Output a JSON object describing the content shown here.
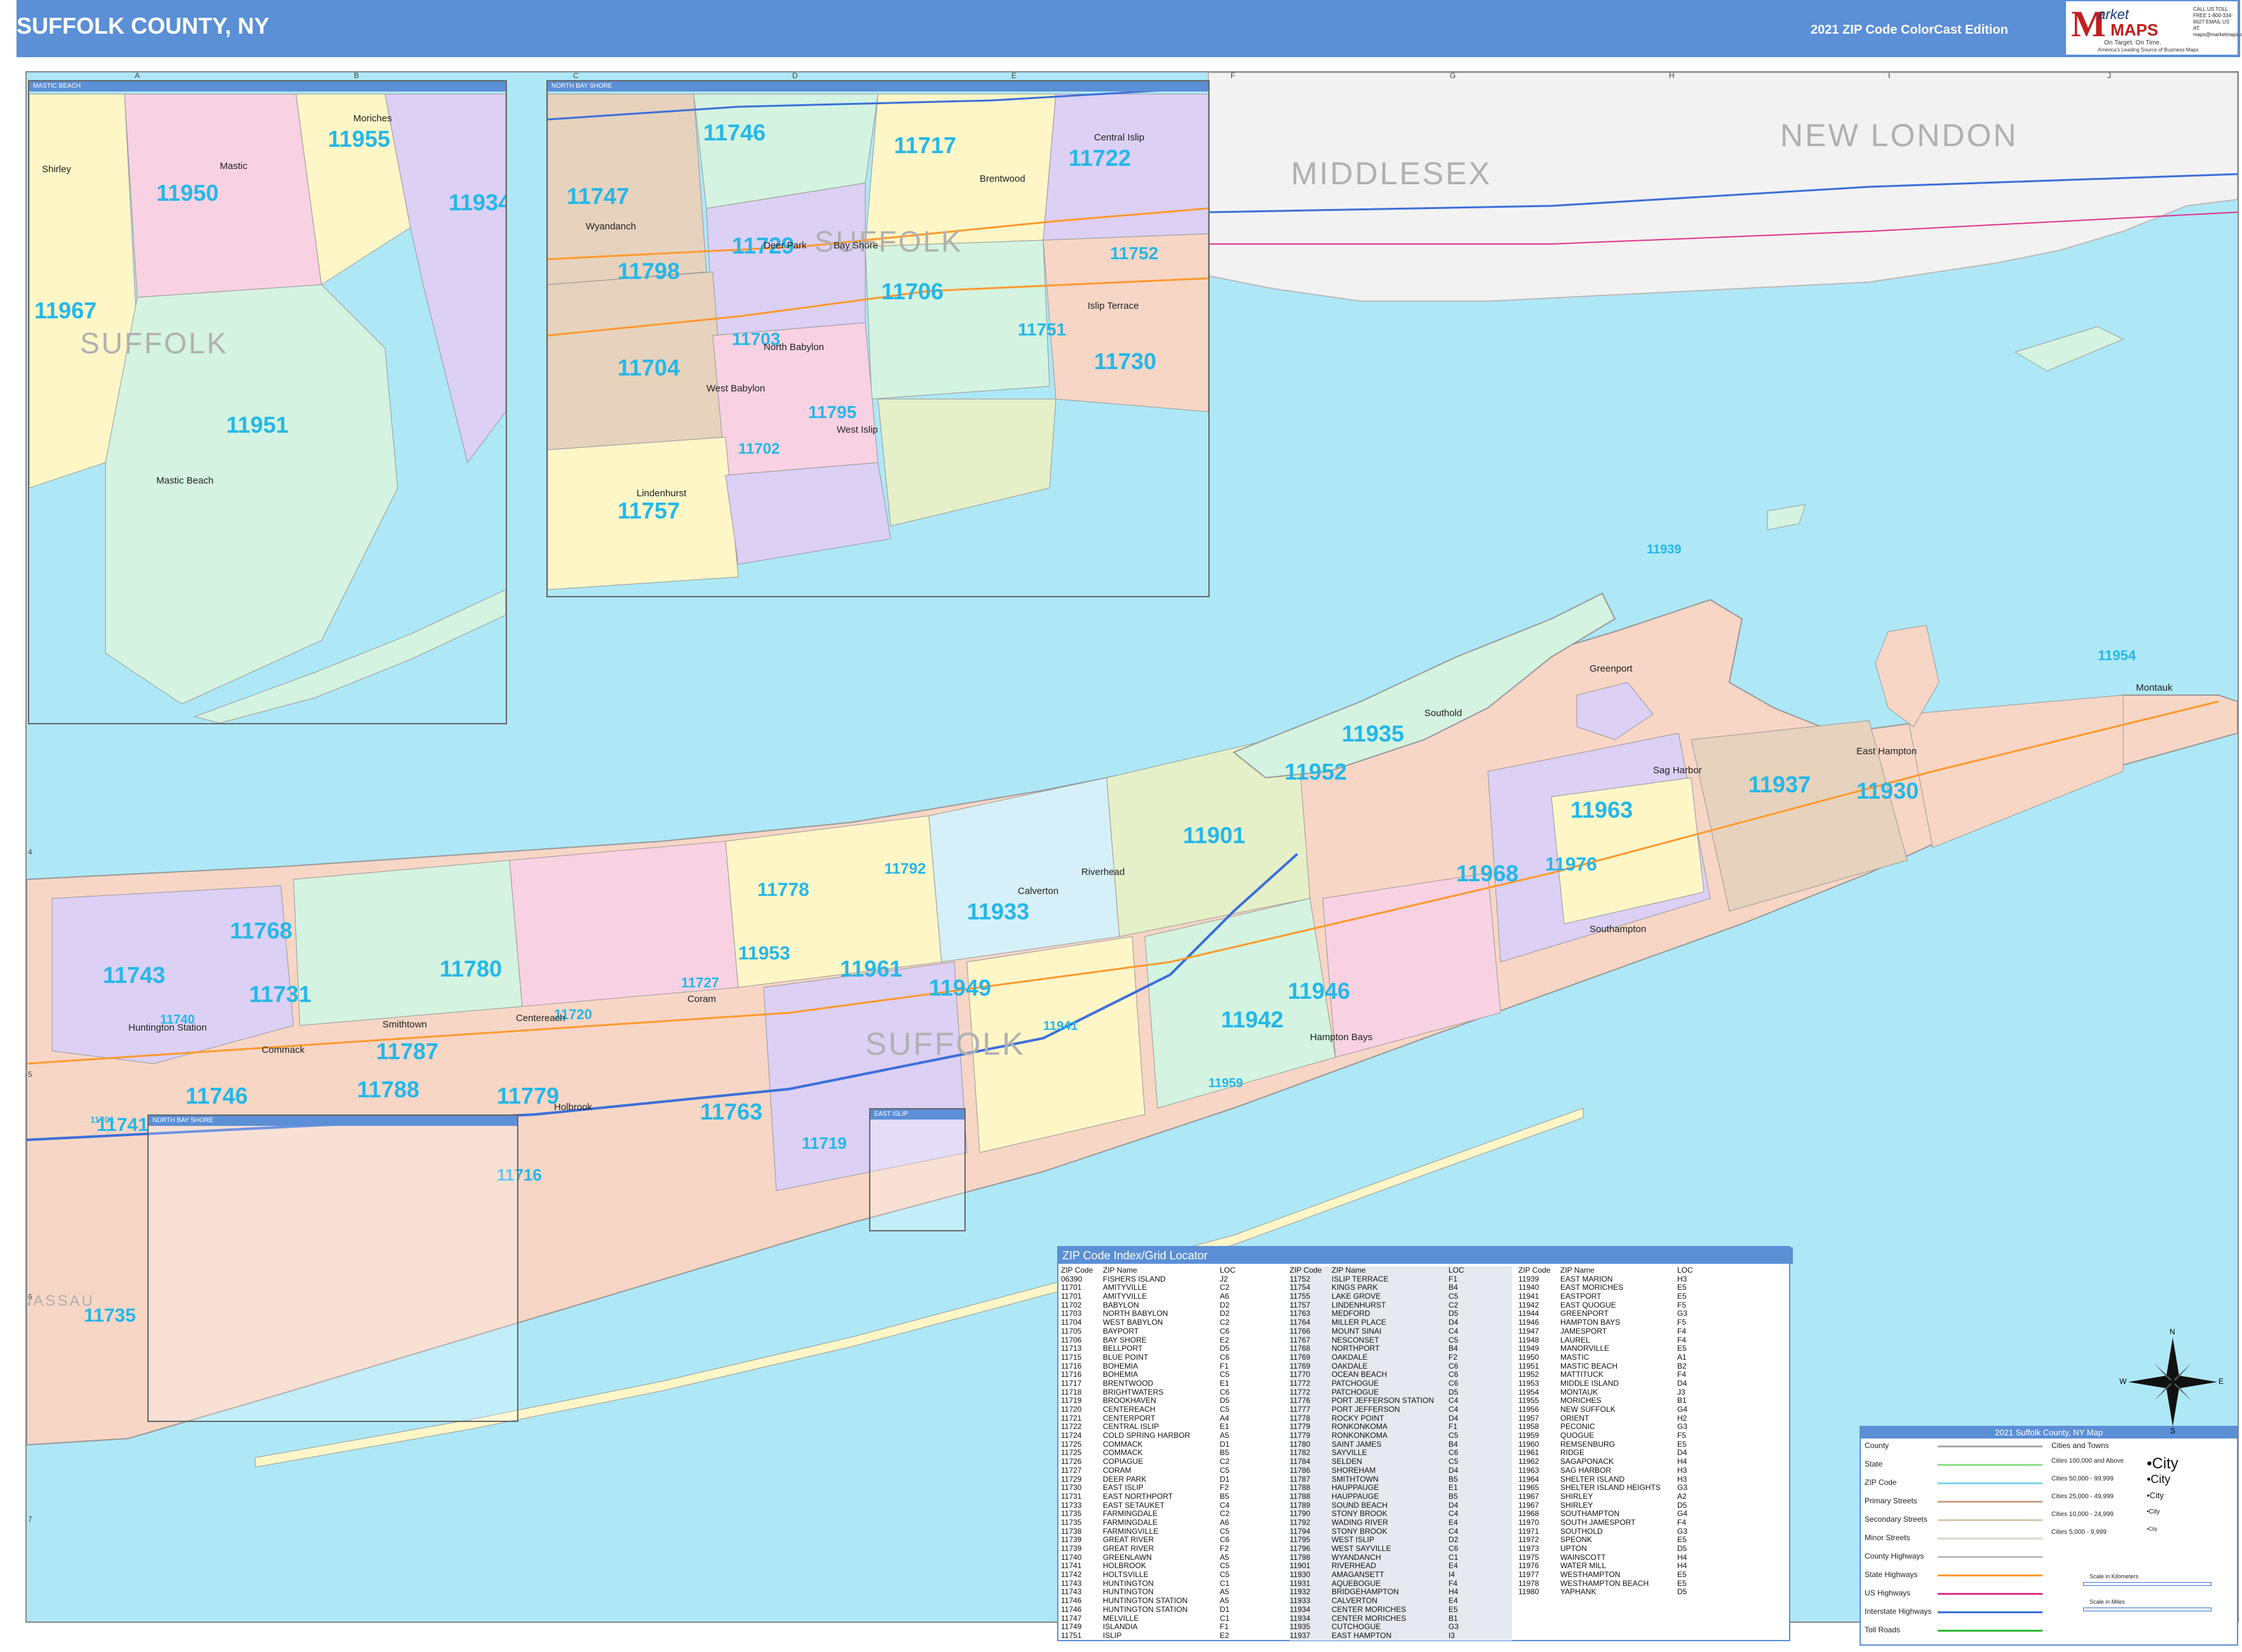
{
  "header": {
    "title": "SUFFOLK COUNTY, NY",
    "edition": "2021 ZIP Code ColorCast Edition",
    "logo": {
      "m": "M",
      "arket": "arket",
      "maps": "MAPS",
      "tagline": "On Target. On Time.",
      "subtagline": "America's Leading Source of Business Maps",
      "contact": "CALL US TOLL FREE 1-800-334-6627 EMAIL US AT: maps@marketmaps.com"
    }
  },
  "colors": {
    "header": "#5b8fd6",
    "water": "#aee8f7",
    "zip_label": "#26b7e8",
    "region_label": "#b0b0b0",
    "land_palette": [
      "#f7d6c6",
      "#dcd0f5",
      "#d4f3e0",
      "#fff6c8",
      "#f8d2e2",
      "#d6f0f9",
      "#e6d2bd",
      "#e5f0c8"
    ]
  },
  "grid": {
    "columns": [
      "A",
      "B",
      "C",
      "D",
      "E",
      "F",
      "G",
      "H",
      "I",
      "J"
    ],
    "rows": [
      "1",
      "2",
      "3",
      "4",
      "5",
      "6",
      "7"
    ]
  },
  "regions": [
    "MIDDLESEX",
    "NEW LONDON",
    "SUFFOLK",
    "NASSAU"
  ],
  "insets": {
    "mastic_beach": {
      "title": "MASTIC BEACH",
      "zips": [
        "11955",
        "11950",
        "11934",
        "11967",
        "11951"
      ],
      "region": "SUFFOLK",
      "places": [
        "Shirley",
        "Mastic",
        "Moriches",
        "Mastic Beach"
      ]
    },
    "north_bay_shore": {
      "title": "NORTH BAY SHORE",
      "zips": [
        "11746",
        "11717",
        "11722",
        "11747",
        "11729",
        "11798",
        "11706",
        "11752",
        "11704",
        "11703",
        "11751",
        "11730",
        "11795",
        "11702",
        "11757"
      ],
      "region": "SUFFOLK",
      "places": [
        "Brentwood",
        "Central Islip",
        "Deer Park",
        "Bay Shore",
        "West Babylon",
        "West Islip",
        "Lindenhurst",
        "North Babylon",
        "Islip Terrace",
        "Wyandanch"
      ]
    },
    "lower_left_title": "NORTH BAY SHORE",
    "lower_right_title": "EAST ISLIP"
  },
  "main_map": {
    "zips": [
      "11954",
      "11939",
      "11935",
      "11952",
      "11937",
      "11930",
      "11963",
      "11901",
      "11968",
      "11976",
      "11933",
      "11778",
      "11768",
      "11743",
      "11731",
      "11780",
      "11961",
      "11949",
      "11946",
      "11942",
      "11787",
      "11953",
      "11788",
      "11746",
      "11779",
      "11763",
      "11741",
      "11716",
      "11719",
      "11740",
      "11727",
      "11720",
      "11941",
      "11959",
      "11792",
      "11735",
      "11701"
    ],
    "places": [
      "Huntington Station",
      "Commack",
      "Smithtown",
      "Centereach",
      "Coram",
      "Holbrook",
      "Riverhead",
      "Southold",
      "Greenport",
      "Sag Harbor",
      "Southampton",
      "East Hampton",
      "Montauk",
      "Calverton",
      "Hampton Bays"
    ]
  },
  "index": {
    "title": "ZIP Code Index/Grid Locator",
    "headers": [
      "ZIP Code",
      "ZIP Name",
      "LOC"
    ],
    "rows": [
      [
        "06390",
        "FISHERS ISLAND",
        "J2"
      ],
      [
        "11701",
        "AMITYVILLE",
        "C2"
      ],
      [
        "11701",
        "AMITYVILLE",
        "A6"
      ],
      [
        "11702",
        "BABYLON",
        "D2"
      ],
      [
        "11703",
        "NORTH BABYLON",
        "D2"
      ],
      [
        "11704",
        "WEST BABYLON",
        "C2"
      ],
      [
        "11705",
        "BAYPORT",
        "C6"
      ],
      [
        "11706",
        "BAY SHORE",
        "E2"
      ],
      [
        "11713",
        "BELLPORT",
        "D5"
      ],
      [
        "11715",
        "BLUE POINT",
        "C6"
      ],
      [
        "11716",
        "BOHEMIA",
        "F1"
      ],
      [
        "11716",
        "BOHEMIA",
        "C5"
      ],
      [
        "11717",
        "BRENTWOOD",
        "E1"
      ],
      [
        "11718",
        "BRIGHTWATERS",
        "C6"
      ],
      [
        "11719",
        "BROOKHAVEN",
        "D5"
      ],
      [
        "11720",
        "CENTEREACH",
        "C5"
      ],
      [
        "11721",
        "CENTERPORT",
        "A4"
      ],
      [
        "11722",
        "CENTRAL ISLIP",
        "E1"
      ],
      [
        "11724",
        "COLD SPRING HARBOR",
        "A5"
      ],
      [
        "11725",
        "COMMACK",
        "D1"
      ],
      [
        "11725",
        "COMMACK",
        "B5"
      ],
      [
        "11726",
        "COPIAGUE",
        "C2"
      ],
      [
        "11727",
        "CORAM",
        "C5"
      ],
      [
        "11729",
        "DEER PARK",
        "D1"
      ],
      [
        "11730",
        "EAST ISLIP",
        "F2"
      ],
      [
        "11731",
        "EAST NORTHPORT",
        "B5"
      ],
      [
        "11733",
        "EAST SETAUKET",
        "C4"
      ],
      [
        "11735",
        "FARMINGDALE",
        "C2"
      ],
      [
        "11735",
        "FARMINGDALE",
        "A6"
      ],
      [
        "11738",
        "FARMINGVILLE",
        "C5"
      ],
      [
        "11739",
        "GREAT RIVER",
        "C6"
      ],
      [
        "11739",
        "GREAT RIVER",
        "F2"
      ],
      [
        "11740",
        "GREENLAWN",
        "A5"
      ],
      [
        "11741",
        "HOLBROOK",
        "C5"
      ],
      [
        "11742",
        "HOLTSVILLE",
        "C5"
      ],
      [
        "11743",
        "HUNTINGTON",
        "C1"
      ],
      [
        "11743",
        "HUNTINGTON",
        "A5"
      ],
      [
        "11746",
        "HUNTINGTON STATION",
        "A5"
      ],
      [
        "11746",
        "HUNTINGTON STATION",
        "D1"
      ],
      [
        "11747",
        "MELVILLE",
        "C1"
      ],
      [
        "11749",
        "ISLANDIA",
        "F1"
      ],
      [
        "11751",
        "ISLIP",
        "E2"
      ],
      [
        "11752",
        "ISLIP TERRACE",
        "F1"
      ],
      [
        "11754",
        "KINGS PARK",
        "B4"
      ],
      [
        "11755",
        "LAKE GROVE",
        "C5"
      ],
      [
        "11757",
        "LINDENHURST",
        "C2"
      ],
      [
        "11763",
        "MEDFORD",
        "D5"
      ],
      [
        "11764",
        "MILLER PLACE",
        "D4"
      ],
      [
        "11766",
        "MOUNT SINAI",
        "C4"
      ],
      [
        "11767",
        "NESCONSET",
        "C5"
      ],
      [
        "11768",
        "NORTHPORT",
        "B4"
      ],
      [
        "11769",
        "OAKDALE",
        "F2"
      ],
      [
        "11769",
        "OAKDALE",
        "C6"
      ],
      [
        "11770",
        "OCEAN BEACH",
        "C6"
      ],
      [
        "11772",
        "PATCHOGUE",
        "C6"
      ],
      [
        "11772",
        "PATCHOGUE",
        "D5"
      ],
      [
        "11776",
        "PORT JEFFERSON STATION",
        "C4"
      ],
      [
        "11777",
        "PORT JEFFERSON",
        "C4"
      ],
      [
        "11778",
        "ROCKY POINT",
        "D4"
      ],
      [
        "11779",
        "RONKONKOMA",
        "F1"
      ],
      [
        "11779",
        "RONKONKOMA",
        "C5"
      ],
      [
        "11780",
        "SAINT JAMES",
        "B4"
      ],
      [
        "11782",
        "SAYVILLE",
        "C6"
      ],
      [
        "11784",
        "SELDEN",
        "C5"
      ],
      [
        "11786",
        "SHOREHAM",
        "D4"
      ],
      [
        "11787",
        "SMITHTOWN",
        "B5"
      ],
      [
        "11788",
        "HAUPPAUGE",
        "E1"
      ],
      [
        "11788",
        "HAUPPAUGE",
        "B5"
      ],
      [
        "11789",
        "SOUND BEACH",
        "D4"
      ],
      [
        "11790",
        "STONY BROOK",
        "C4"
      ],
      [
        "11792",
        "WADING RIVER",
        "E4"
      ],
      [
        "11794",
        "STONY BROOK",
        "C4"
      ],
      [
        "11795",
        "WEST ISLIP",
        "D2"
      ],
      [
        "11796",
        "WEST SAYVILLE",
        "C6"
      ],
      [
        "11798",
        "WYANDANCH",
        "C1"
      ],
      [
        "11901",
        "RIVERHEAD",
        "E4"
      ],
      [
        "11930",
        "AMAGANSETT",
        "I4"
      ],
      [
        "11931",
        "AQUEBOGUE",
        "F4"
      ],
      [
        "11932",
        "BRIDGEHAMPTON",
        "H4"
      ],
      [
        "11933",
        "CALVERTON",
        "E4"
      ],
      [
        "11934",
        "CENTER MORICHES",
        "E5"
      ],
      [
        "11934",
        "CENTER MORICHES",
        "B1"
      ],
      [
        "11935",
        "CUTCHOGUE",
        "G3"
      ],
      [
        "11937",
        "EAST HAMPTON",
        "I3"
      ],
      [
        "11939",
        "EAST MARION",
        "H3"
      ],
      [
        "11940",
        "EAST MORICHES",
        "E5"
      ],
      [
        "11941",
        "EASTPORT",
        "E5"
      ],
      [
        "11942",
        "EAST QUOGUE",
        "F5"
      ],
      [
        "11944",
        "GREENPORT",
        "G3"
      ],
      [
        "11946",
        "HAMPTON BAYS",
        "F5"
      ],
      [
        "11947",
        "JAMESPORT",
        "F4"
      ],
      [
        "11948",
        "LAUREL",
        "F4"
      ],
      [
        "11949",
        "MANORVILLE",
        "E5"
      ],
      [
        "11950",
        "MASTIC",
        "A1"
      ],
      [
        "11951",
        "MASTIC BEACH",
        "B2"
      ],
      [
        "11952",
        "MATTITUCK",
        "F4"
      ],
      [
        "11953",
        "MIDDLE ISLAND",
        "D4"
      ],
      [
        "11954",
        "MONTAUK",
        "J3"
      ],
      [
        "11955",
        "MORICHES",
        "B1"
      ],
      [
        "11956",
        "NEW SUFFOLK",
        "G4"
      ],
      [
        "11957",
        "ORIENT",
        "H2"
      ],
      [
        "11958",
        "PECONIC",
        "G3"
      ],
      [
        "11959",
        "QUOGUE",
        "F5"
      ],
      [
        "11960",
        "REMSENBURG",
        "E5"
      ],
      [
        "11961",
        "RIDGE",
        "D4"
      ],
      [
        "11962",
        "SAGAPONACK",
        "H4"
      ],
      [
        "11963",
        "SAG HARBOR",
        "H3"
      ],
      [
        "11964",
        "SHELTER ISLAND",
        "H3"
      ],
      [
        "11965",
        "SHELTER ISLAND HEIGHTS",
        "G3"
      ],
      [
        "11967",
        "SHIRLEY",
        "A2"
      ],
      [
        "11967",
        "SHIRLEY",
        "D5"
      ],
      [
        "11968",
        "SOUTHAMPTON",
        "G4"
      ],
      [
        "11970",
        "SOUTH JAMESPORT",
        "F4"
      ],
      [
        "11971",
        "SOUTHOLD",
        "G3"
      ],
      [
        "11972",
        "SPEONK",
        "E5"
      ],
      [
        "11973",
        "UPTON",
        "D5"
      ],
      [
        "11975",
        "WAINSCOTT",
        "H4"
      ],
      [
        "11976",
        "WATER MILL",
        "H4"
      ],
      [
        "11977",
        "WESTHAMPTON",
        "E5"
      ],
      [
        "11978",
        "WESTHAMPTON BEACH",
        "E5"
      ],
      [
        "11980",
        "YAPHANK",
        "D5"
      ]
    ]
  },
  "legend": {
    "title": "2021 Suffolk County, NY Map",
    "items": [
      "County",
      "State",
      "ZIP Code",
      "Primary Streets",
      "Secondary Streets",
      "Minor Streets",
      "County Highways",
      "State Highways",
      "US Highways",
      "Interstate Highways",
      "Toll Roads"
    ],
    "cities_heading": "Cities and Towns",
    "cities": [
      {
        "range": "Cities 100,000 and Above",
        "sample": "City"
      },
      {
        "range": "Cities 50,000 - 99,999",
        "sample": "City"
      },
      {
        "range": "Cities 25,000 - 49,999",
        "sample": "City"
      },
      {
        "range": "Cities 10,000 - 24,999",
        "sample": "City"
      },
      {
        "range": "Cities 5,000 - 9,999",
        "sample": "City"
      }
    ],
    "scale_km": "Scale in Kilometers",
    "scale_mi": "Scale in Miles",
    "line_colors": [
      "#aaaaaa",
      "#8fe08f",
      "#7fd6e8",
      "#c9a38a",
      "#d8c6b0",
      "#e0d6cc",
      "#bbbbbb",
      "#ff9a2e",
      "#e0338f",
      "#3c6fd8",
      "#2eb82e"
    ]
  },
  "compass": {
    "n": "N",
    "s": "S",
    "e": "E",
    "w": "W"
  }
}
